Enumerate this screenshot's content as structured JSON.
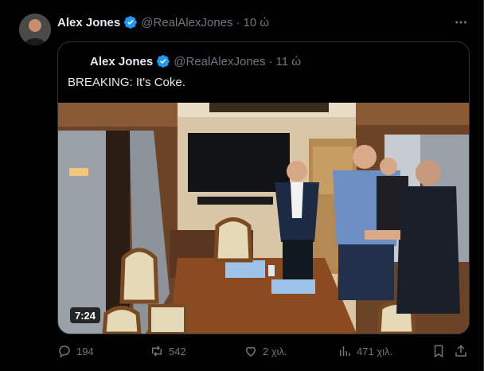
{
  "tweet": {
    "author_name": "Alex Jones",
    "handle": "@RealAlexJones",
    "separator": "·",
    "time": "10 ώ"
  },
  "quote": {
    "author_name": "Alex Jones",
    "handle": "@RealAlexJones",
    "separator": "·",
    "time": "11 ώ",
    "text": "BREAKING: It's Coke.",
    "video_duration": "7:24"
  },
  "actions": {
    "replies": "194",
    "reposts": "542",
    "likes": "2 χιλ.",
    "views": "471 χιλ."
  },
  "icons": {
    "verified": "verified-badge-icon",
    "more": "more-horizontal-icon",
    "reply": "reply-icon",
    "repost": "repost-icon",
    "like": "heart-icon",
    "views": "views-chart-icon",
    "bookmark": "bookmark-icon",
    "share": "share-icon"
  },
  "colors": {
    "background": "#000000",
    "text": "#e7e9ea",
    "muted": "#71767b",
    "border": "#2f3336",
    "verified": "#1d9bf0"
  }
}
